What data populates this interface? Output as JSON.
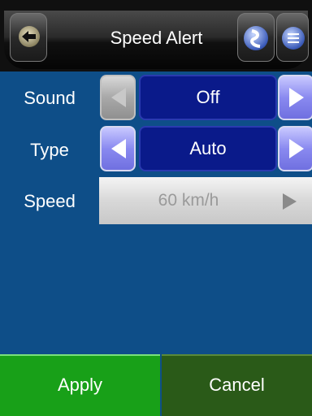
{
  "header": {
    "title": "Speed Alert",
    "back_icon": "back-arrow-icon",
    "nav_icon": "navigation-icon",
    "menu_icon": "menu-icon"
  },
  "rows": {
    "sound": {
      "label": "Sound",
      "value": "Off",
      "left_enabled": false,
      "right_enabled": true
    },
    "type": {
      "label": "Type",
      "value": "Auto",
      "left_enabled": true,
      "right_enabled": true
    },
    "speed": {
      "label": "Speed",
      "value": "60 km/h"
    }
  },
  "footer": {
    "apply_label": "Apply",
    "cancel_label": "Cancel"
  },
  "colors": {
    "background": "#0e4e88",
    "value_box": "#0a1a8a",
    "arrow_active": "#8a8af0",
    "apply": "#18a018",
    "cancel": "#2a5a18"
  }
}
